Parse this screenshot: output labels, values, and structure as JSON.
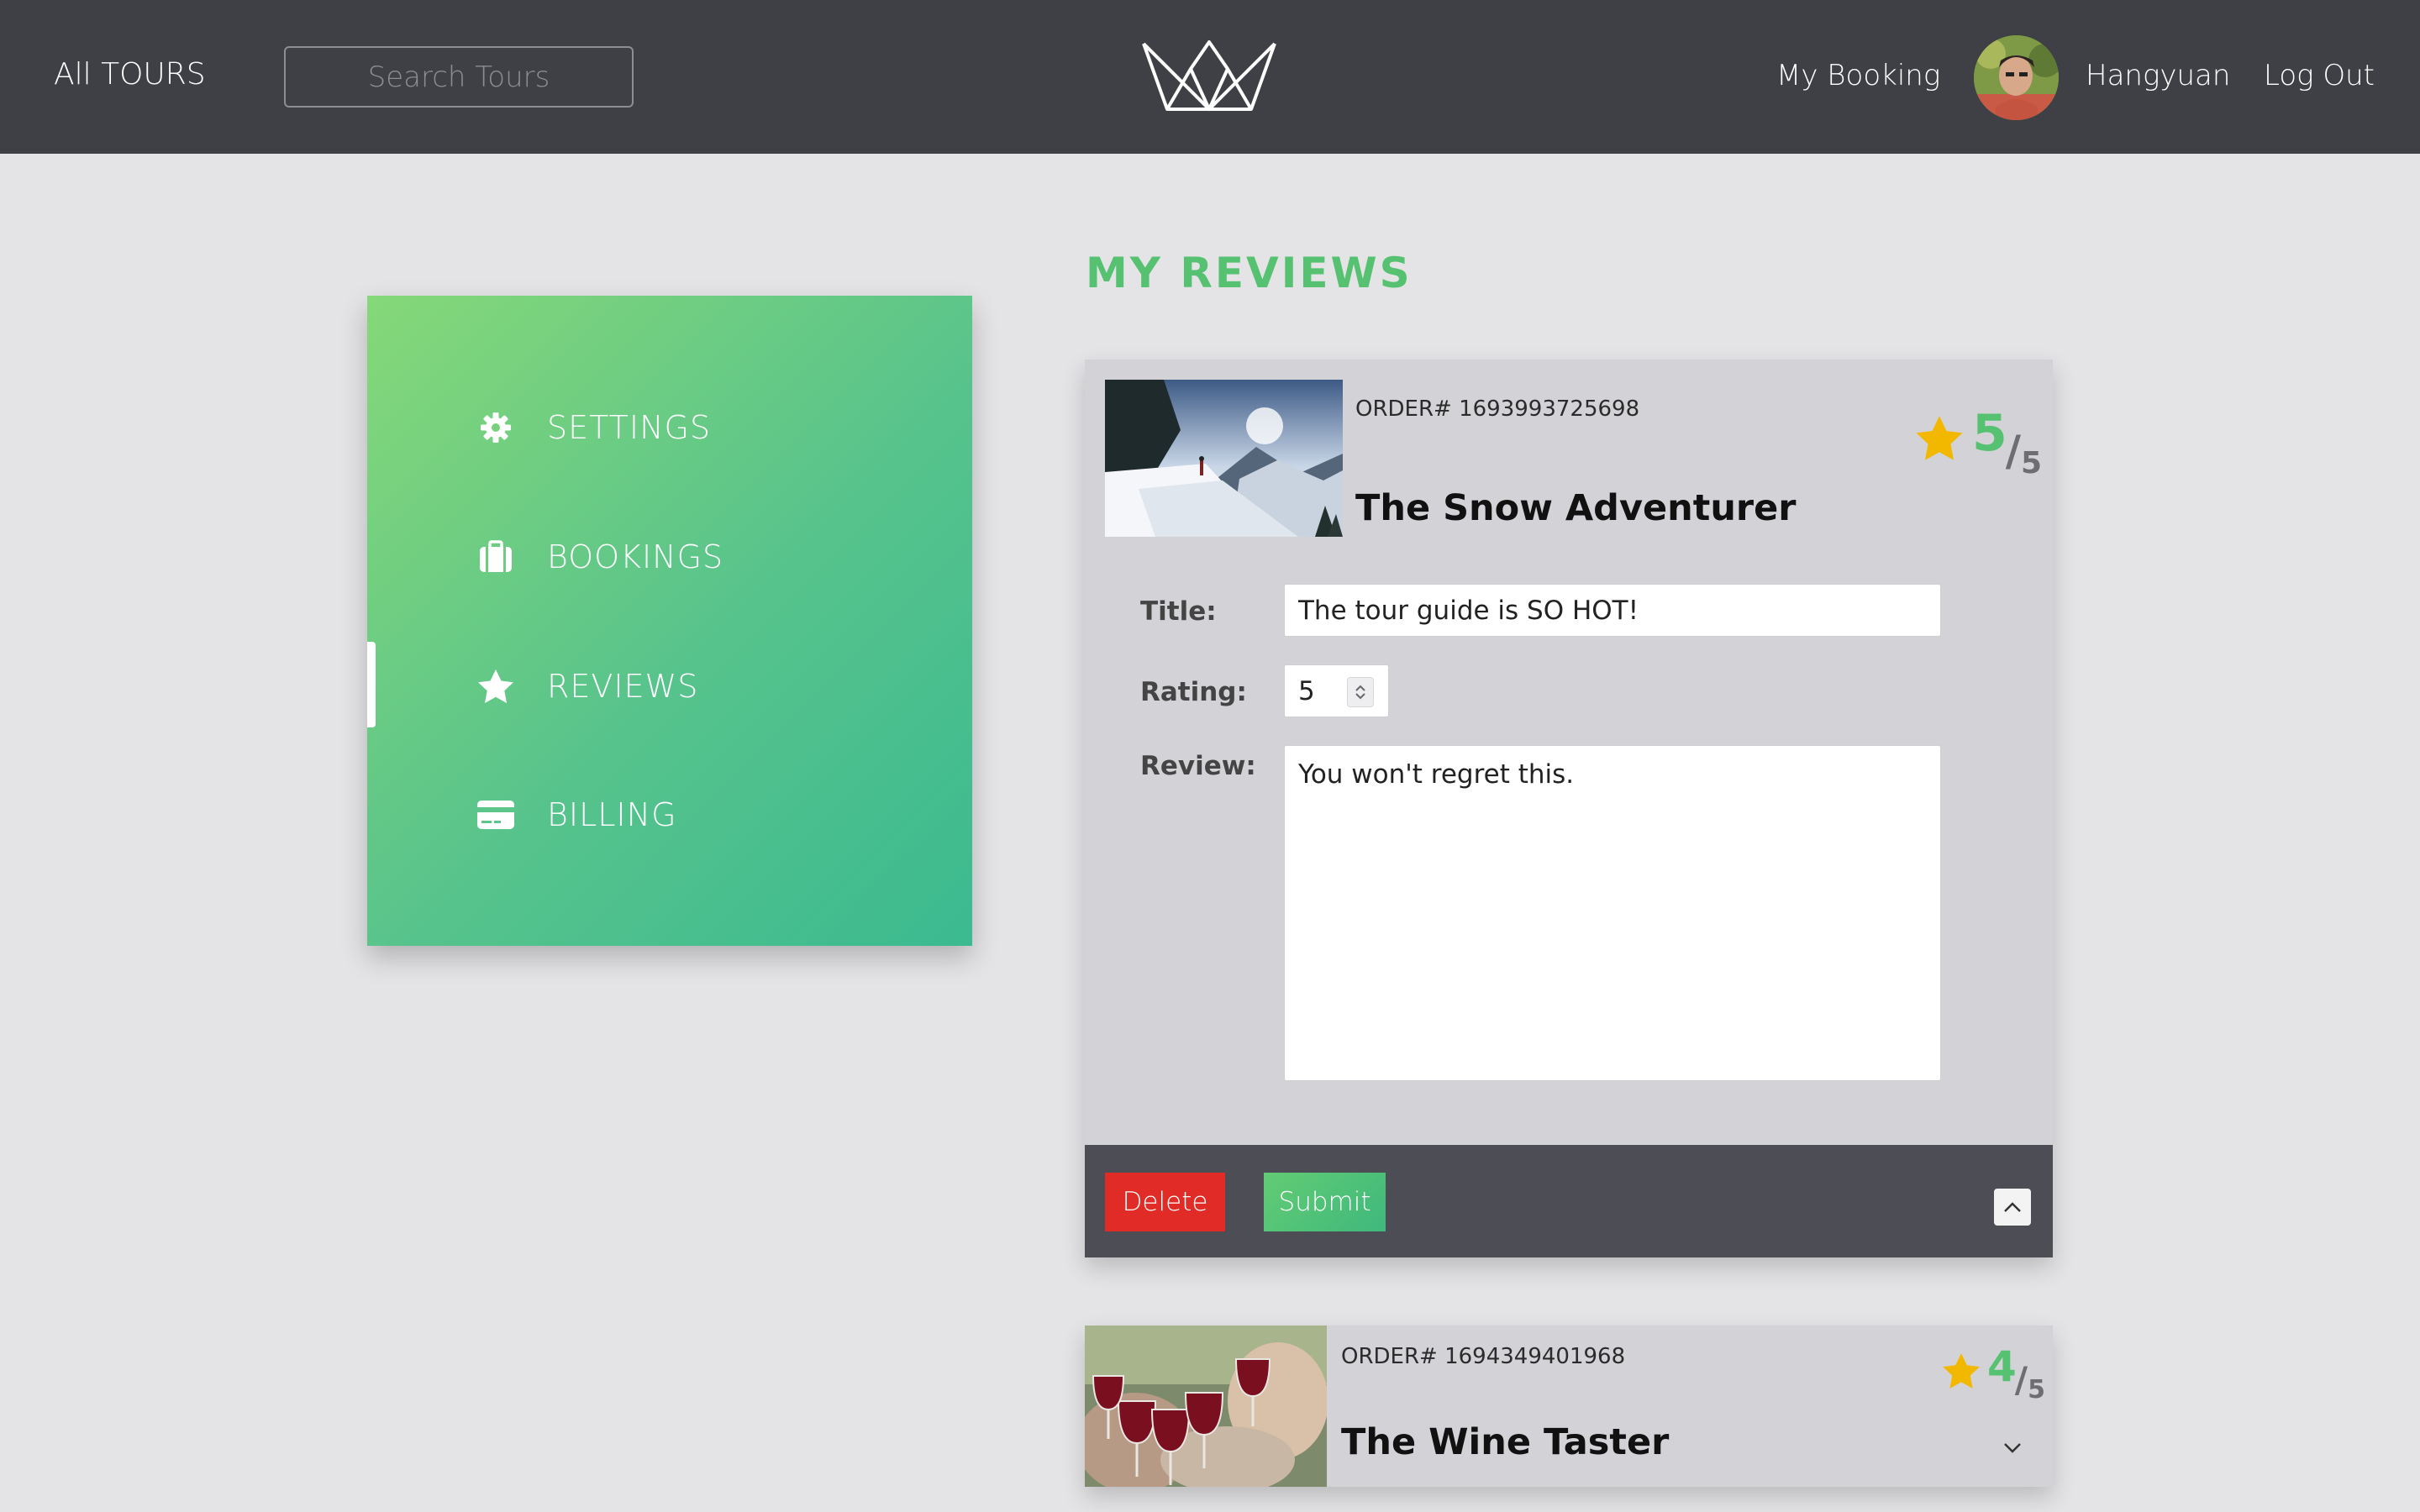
{
  "header": {
    "all_tours": "All TOURS",
    "search_placeholder": "Search Tours",
    "my_booking": "My Booking",
    "user_name": "Hangyuan",
    "log_out": "Log Out"
  },
  "sidebar": {
    "items": [
      {
        "label": "SETTINGS",
        "icon": "gear-icon"
      },
      {
        "label": "BOOKINGS",
        "icon": "suitcase-icon"
      },
      {
        "label": "REVIEWS",
        "icon": "star-icon",
        "active": true
      },
      {
        "label": "BILLING",
        "icon": "credit-card-icon"
      }
    ]
  },
  "main": {
    "title": "MY REVIEWS",
    "reviews": [
      {
        "order": "ORDER# 1693993725698",
        "tour": "The Snow Adventurer",
        "rating": "5",
        "rating_max": "5",
        "expanded": true,
        "form": {
          "title_label": "Title:",
          "title_value": "The tour guide is SO HOT!",
          "rating_label": "Rating:",
          "rating_value": "5",
          "review_label": "Review:",
          "review_value": "You won't regret this."
        },
        "delete_label": "Delete",
        "submit_label": "Submit"
      },
      {
        "order": "ORDER# 1694349401968",
        "tour": "The Wine Taster",
        "rating": "4",
        "rating_max": "5",
        "expanded": false
      }
    ]
  },
  "colors": {
    "header_bg": "#3f4045",
    "page_bg": "#e4e4e6",
    "accent_green": "#56c271",
    "star_gold": "#f2b800",
    "delete_red": "#e02b26",
    "footer_dark": "#4d4e55"
  }
}
